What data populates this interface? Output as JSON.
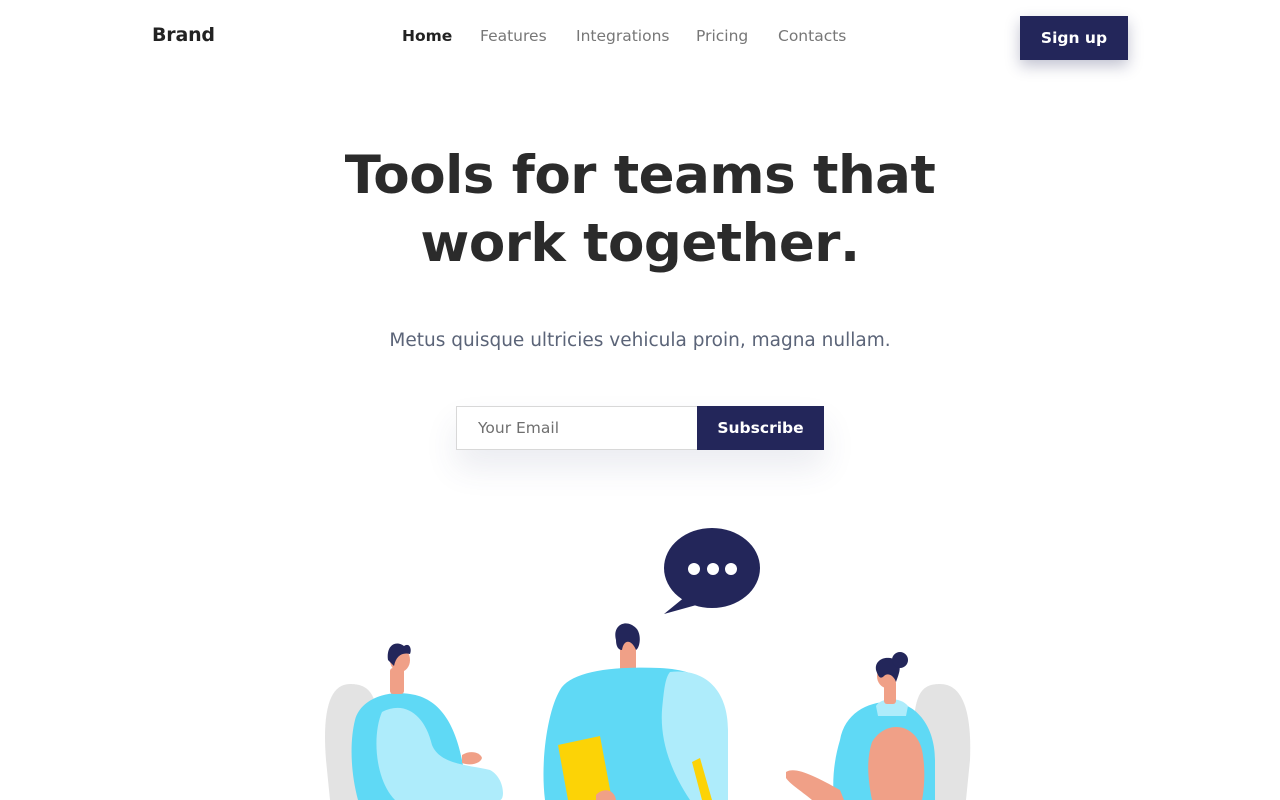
{
  "header": {
    "brand": "Brand",
    "nav": [
      {
        "label": "Home",
        "active": true
      },
      {
        "label": "Features",
        "active": false
      },
      {
        "label": "Integrations",
        "active": false
      },
      {
        "label": "Pricing",
        "active": false
      },
      {
        "label": "Contacts",
        "active": false
      }
    ],
    "signup_label": "Sign up"
  },
  "hero": {
    "headline_line1": "Tools for teams that",
    "headline_line2_start": "work ",
    "headline_highlight": "together",
    "headline_end": ".",
    "subtitle": "Metus quisque ultricies vehicula proin, magna nullam."
  },
  "subscribe": {
    "email_placeholder": "Your Email",
    "email_value": "",
    "button_label": "Subscribe"
  },
  "illustration": {
    "speech_bubble_icon": "speech-bubble-ellipsis-icon",
    "people": [
      "person-left-seated",
      "person-center-holding-folder",
      "person-right-seated"
    ]
  },
  "colors": {
    "primary": "#23265a",
    "accent": "#f9d308",
    "text_dark": "#2b2b2b",
    "text_muted": "#777777",
    "subtitle": "#5b6478",
    "skin": "#f0a087",
    "shirt_light": "#aeecfb",
    "shirt": "#5fd9f5",
    "chair": "#e3e3e3"
  }
}
